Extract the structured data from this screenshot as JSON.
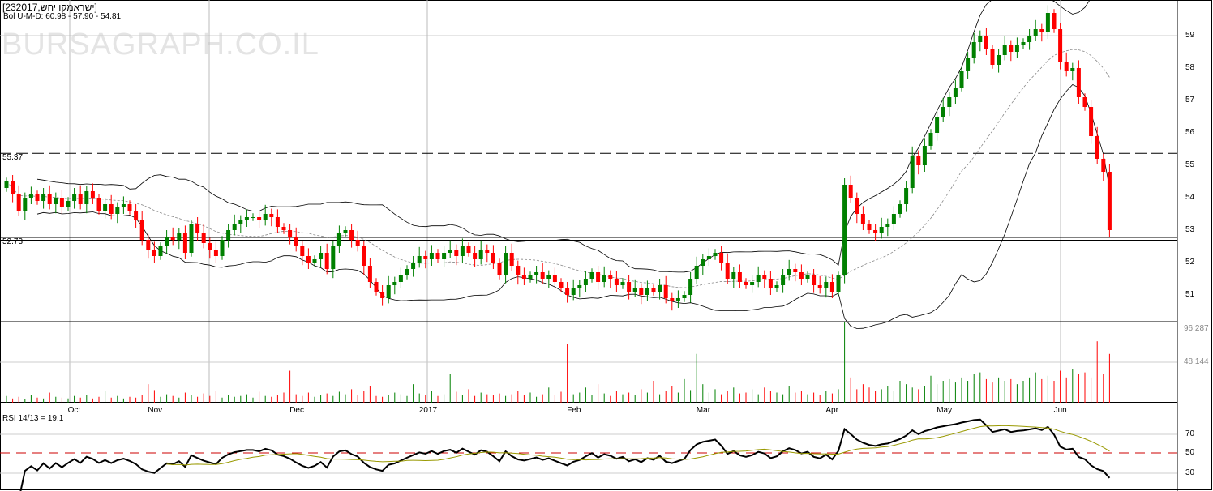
{
  "header": {
    "symbol": "[232017,ישראמקו יהש]",
    "bollinger": "Bol U-M-D: 60.98 - 57.90 - 54.81",
    "watermark": "BURSAGRAPH.CO.IL"
  },
  "colors": {
    "up": "#008000",
    "down": "#ff0000",
    "rsi": "#000000",
    "rsi_ma": "#999900",
    "ref": "#000000"
  },
  "chart_data": {
    "type": "candlestick",
    "price_axis": {
      "range": [
        50.2,
        60.1
      ],
      "ticks": [
        51,
        52,
        53,
        54,
        55,
        56,
        57,
        58,
        59
      ]
    },
    "reference_lines": [
      {
        "value": 55.37,
        "label": "55.37",
        "style": "dashed"
      },
      {
        "value": 52.73,
        "label": "52.73",
        "style": "solid"
      }
    ],
    "x_labels": [
      {
        "label": "Oct",
        "index": 11
      },
      {
        "label": "Nov",
        "index": 24
      },
      {
        "label": "Dec",
        "index": 47
      },
      {
        "label": "2017",
        "index": 68
      },
      {
        "label": "Feb",
        "index": 92
      },
      {
        "label": "Mar",
        "index": 113
      },
      {
        "label": "Apr",
        "index": 134
      },
      {
        "label": "May",
        "index": 152
      },
      {
        "label": "Jun",
        "index": 171
      }
    ],
    "first_open": 54.3,
    "close": [
      54.5,
      54.1,
      53.6,
      54.0,
      54.1,
      53.9,
      54.1,
      53.8,
      54.0,
      53.7,
      53.9,
      54.1,
      53.8,
      54.2,
      54.0,
      53.6,
      53.8,
      53.5,
      53.7,
      53.8,
      53.6,
      53.3,
      52.7,
      52.4,
      52.2,
      52.5,
      52.8,
      52.7,
      52.9,
      52.3,
      53.2,
      52.9,
      52.6,
      52.4,
      52.2,
      52.7,
      53.0,
      53.2,
      53.3,
      53.4,
      53.4,
      53.3,
      53.5,
      53.4,
      53.1,
      53.0,
      52.8,
      52.5,
      52.2,
      52.0,
      52.1,
      52.3,
      51.8,
      52.5,
      52.9,
      53.0,
      52.7,
      52.5,
      51.9,
      51.4,
      51.1,
      50.9,
      51.3,
      51.4,
      51.6,
      51.8,
      52.0,
      52.2,
      52.1,
      52.3,
      52.1,
      52.3,
      52.4,
      52.2,
      52.5,
      52.3,
      52.1,
      52.4,
      52.3,
      52.0,
      51.6,
      52.3,
      51.9,
      51.6,
      51.5,
      51.6,
      51.7,
      51.5,
      51.6,
      51.4,
      51.2,
      51.0,
      51.2,
      51.3,
      51.5,
      51.7,
      51.4,
      51.6,
      51.5,
      51.3,
      51.4,
      51.1,
      51.2,
      51.0,
      51.2,
      51.1,
      51.3,
      50.9,
      50.8,
      50.9,
      51.0,
      51.5,
      51.9,
      52.1,
      52.2,
      52.3,
      52.0,
      51.5,
      51.7,
      51.4,
      51.3,
      51.4,
      51.6,
      51.5,
      51.2,
      51.3,
      51.6,
      51.8,
      51.7,
      51.5,
      51.6,
      51.3,
      51.2,
      51.4,
      51.1,
      51.6,
      54.4,
      54.0,
      53.5,
      53.2,
      53.0,
      52.9,
      53.1,
      53.2,
      53.5,
      53.8,
      54.3,
      55.3,
      55.0,
      55.6,
      56.0,
      56.5,
      56.8,
      57.1,
      57.4,
      57.9,
      58.3,
      58.8,
      59.0,
      58.6,
      58.1,
      58.4,
      58.7,
      58.5,
      58.7,
      58.8,
      59.0,
      59.2,
      59.1,
      59.7,
      59.2,
      58.2,
      57.9,
      58.0,
      57.1,
      56.8,
      55.9,
      55.2,
      54.8,
      53.0
    ],
    "volume_axis": {
      "max": 96287,
      "ticks": [
        "96,287",
        "48,144"
      ]
    },
    "volume": [
      8000,
      5000,
      7000,
      4000,
      9000,
      6000,
      5000,
      12000,
      7000,
      6000,
      5000,
      8000,
      6000,
      9000,
      5000,
      7000,
      14000,
      6000,
      8000,
      5000,
      7000,
      6000,
      9000,
      22000,
      15000,
      7000,
      10000,
      8000,
      6000,
      12000,
      9000,
      7000,
      11000,
      8000,
      14000,
      6000,
      9000,
      7000,
      8000,
      10000,
      6000,
      13000,
      8000,
      7000,
      9000,
      12000,
      38000,
      10000,
      8000,
      12000,
      7000,
      9000,
      11000,
      8000,
      13000,
      10000,
      16000,
      9000,
      14000,
      20000,
      8000,
      7000,
      9000,
      12000,
      10000,
      8000,
      22000,
      11000,
      9000,
      14000,
      8000,
      10000,
      34000,
      13000,
      9000,
      16000,
      8000,
      12000,
      10000,
      9000,
      11000,
      8000,
      10000,
      14000,
      9000,
      12000,
      7000,
      10000,
      18000,
      9000,
      13000,
      70000,
      10000,
      12000,
      18000,
      9000,
      22000,
      11000,
      8000,
      14000,
      10000,
      12000,
      9000,
      16000,
      12000,
      26000,
      10000,
      14000,
      20000,
      12000,
      28000,
      15000,
      58000,
      22000,
      12000,
      16000,
      10000,
      14000,
      18000,
      11000,
      12000,
      16000,
      10000,
      18000,
      14000,
      12000,
      10000,
      20000,
      12000,
      14000,
      10000,
      12000,
      9000,
      14000,
      11000,
      16000,
      96287,
      30000,
      16000,
      22000,
      18000,
      14000,
      16000,
      20000,
      14000,
      26000,
      22000,
      18000,
      16000,
      20000,
      32000,
      22000,
      26000,
      28000,
      24000,
      30000,
      26000,
      34000,
      36000,
      28000,
      24000,
      30000,
      26000,
      28000,
      22000,
      26000,
      30000,
      36000,
      28000,
      32000,
      26000,
      38000,
      30000,
      40000,
      34000,
      36000,
      30000,
      73000,
      34000,
      58000
    ]
  },
  "rsi": {
    "label": "RSI 14/13 = 19.1",
    "ticks": [
      "70",
      "50",
      "30"
    ]
  }
}
